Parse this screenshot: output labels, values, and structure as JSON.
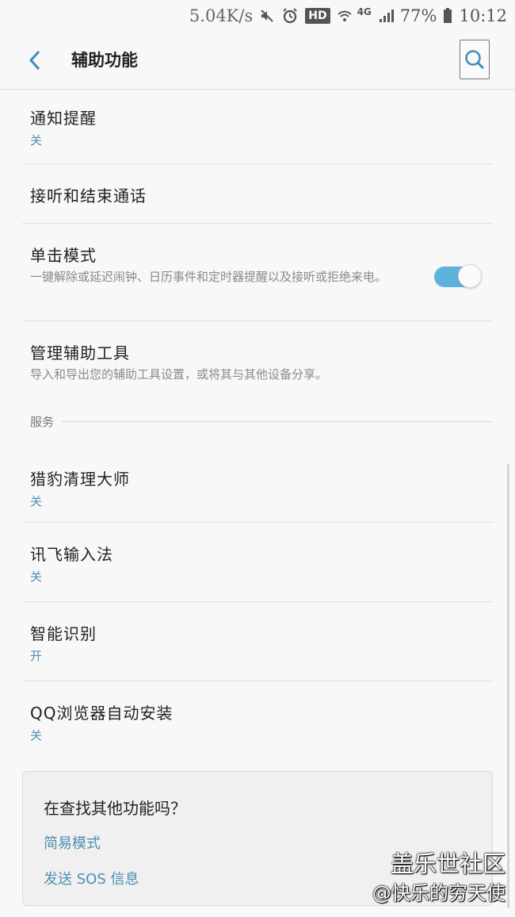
{
  "status_bar": {
    "net_speed": "5.04K/s",
    "hd": "HD",
    "signal_label": "4G",
    "battery_pct": "77%",
    "time": "10:12"
  },
  "appbar": {
    "title": "辅助功能"
  },
  "items": [
    {
      "title": "通知提醒",
      "sub": "关"
    },
    {
      "title": "接听和结束通话"
    },
    {
      "title": "单击模式",
      "desc": "一键解除或延迟闹钟、日历事件和定时器提醒以及接听或拒绝来电。",
      "toggle": "on"
    },
    {
      "title": "管理辅助工具",
      "desc": "导入和导出您的辅助工具设置，或将其与其他设备分享。"
    }
  ],
  "section": {
    "title": "服务"
  },
  "services": [
    {
      "title": "猎豹清理大师",
      "sub": "关"
    },
    {
      "title": "讯飞输入法",
      "sub": "关"
    },
    {
      "title": "智能识别",
      "sub": "开"
    },
    {
      "title": "QQ浏览器自动安装",
      "sub": "关"
    }
  ],
  "card": {
    "title": "在查找其他功能吗？",
    "link1": "简易模式",
    "link2": "发送 SOS 信息"
  },
  "watermark": {
    "line1": "盖乐世社区",
    "line2": "@快乐的穷天使"
  },
  "colors": {
    "accent": "#5db3dc",
    "link": "#4d8fb3"
  }
}
